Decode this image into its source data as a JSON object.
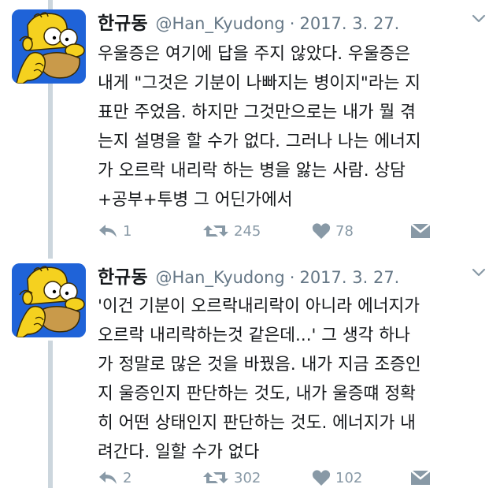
{
  "tweets": [
    {
      "name": "한규동",
      "handle": "@Han_Kyudong",
      "separator": "·",
      "date": "2017. 3. 27.",
      "text": "우울증은 여기에 답을 주지 않았다. 우울증은\n내게 \"그것은 기분이 나빠지는 병이지\"라는 지\n표만 주었음. 하지만 그것만으로는 내가 뭘 겪\n는지 설명을 할 수가 없다. 그러나 나는 에너지\n가 오르락 내리락 하는 병을 앓는 사람. 상담\n+공부+투병 그 어딘가에서",
      "replies": "1",
      "retweets": "245",
      "likes": "78"
    },
    {
      "name": "한규동",
      "handle": "@Han_Kyudong",
      "separator": "·",
      "date": "2017. 3. 27.",
      "text": "'이건 기분이 오르락내리락이 아니라 에너지가\n오르락 내리락하는것 같은데...' 그 생각 하나\n가 정말로 많은 것을 바꿨음. 내가 지금 조증인\n지 울증인지 판단하는 것도, 내가 울증떄 정확\n히 어떤 상태인지 판단하는 것도. 에너지가 내\n려간다. 일할 수가 없다",
      "replies": "2",
      "retweets": "302",
      "likes": "102"
    }
  ],
  "icons": {
    "reply": "reply-icon",
    "retweet": "retweet-icon",
    "like": "heart-icon",
    "dm": "envelope-icon",
    "menu": "chevron-down-icon"
  },
  "colors": {
    "text": "#14171a",
    "secondary": "#657786",
    "action": "#8899a6",
    "thread_line": "#ccd6dd",
    "avatar_bg": "#1f63d8"
  }
}
